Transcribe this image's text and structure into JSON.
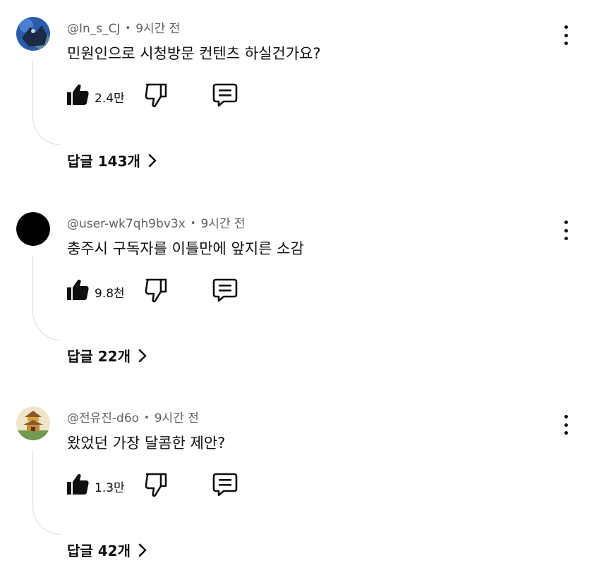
{
  "comments": [
    {
      "author": "@In_s_CJ",
      "time": "9시간 전",
      "text": "민원인으로 시청방문 컨텐츠 하실건가요?",
      "likes": "2.4만",
      "replies": "답글 143개",
      "avatar": "blue-photo"
    },
    {
      "author": "@user-wk7qh9bv3x",
      "time": "9시간 전",
      "text": "충주시 구독자를 이틀만에 앞지른 소감",
      "likes": "9.8천",
      "replies": "답글 22개",
      "avatar": "black-circle"
    },
    {
      "author": "@전유진-d6o",
      "time": "9시간 전",
      "text": "왔었던 가장 달콤한 제안?",
      "likes": "1.3만",
      "replies": "답글 42개",
      "avatar": "pagoda-illustration"
    }
  ],
  "separator": "•",
  "icons": {
    "like": "thumbs-up-icon",
    "dislike": "thumbs-down-icon",
    "reply": "comment-bubble-icon",
    "more": "more-vert-icon",
    "chevron": "chevron-right-icon"
  },
  "colors": {
    "text": "#0f0f0f",
    "meta": "#606060",
    "thread_line": "#dcdcdc"
  }
}
